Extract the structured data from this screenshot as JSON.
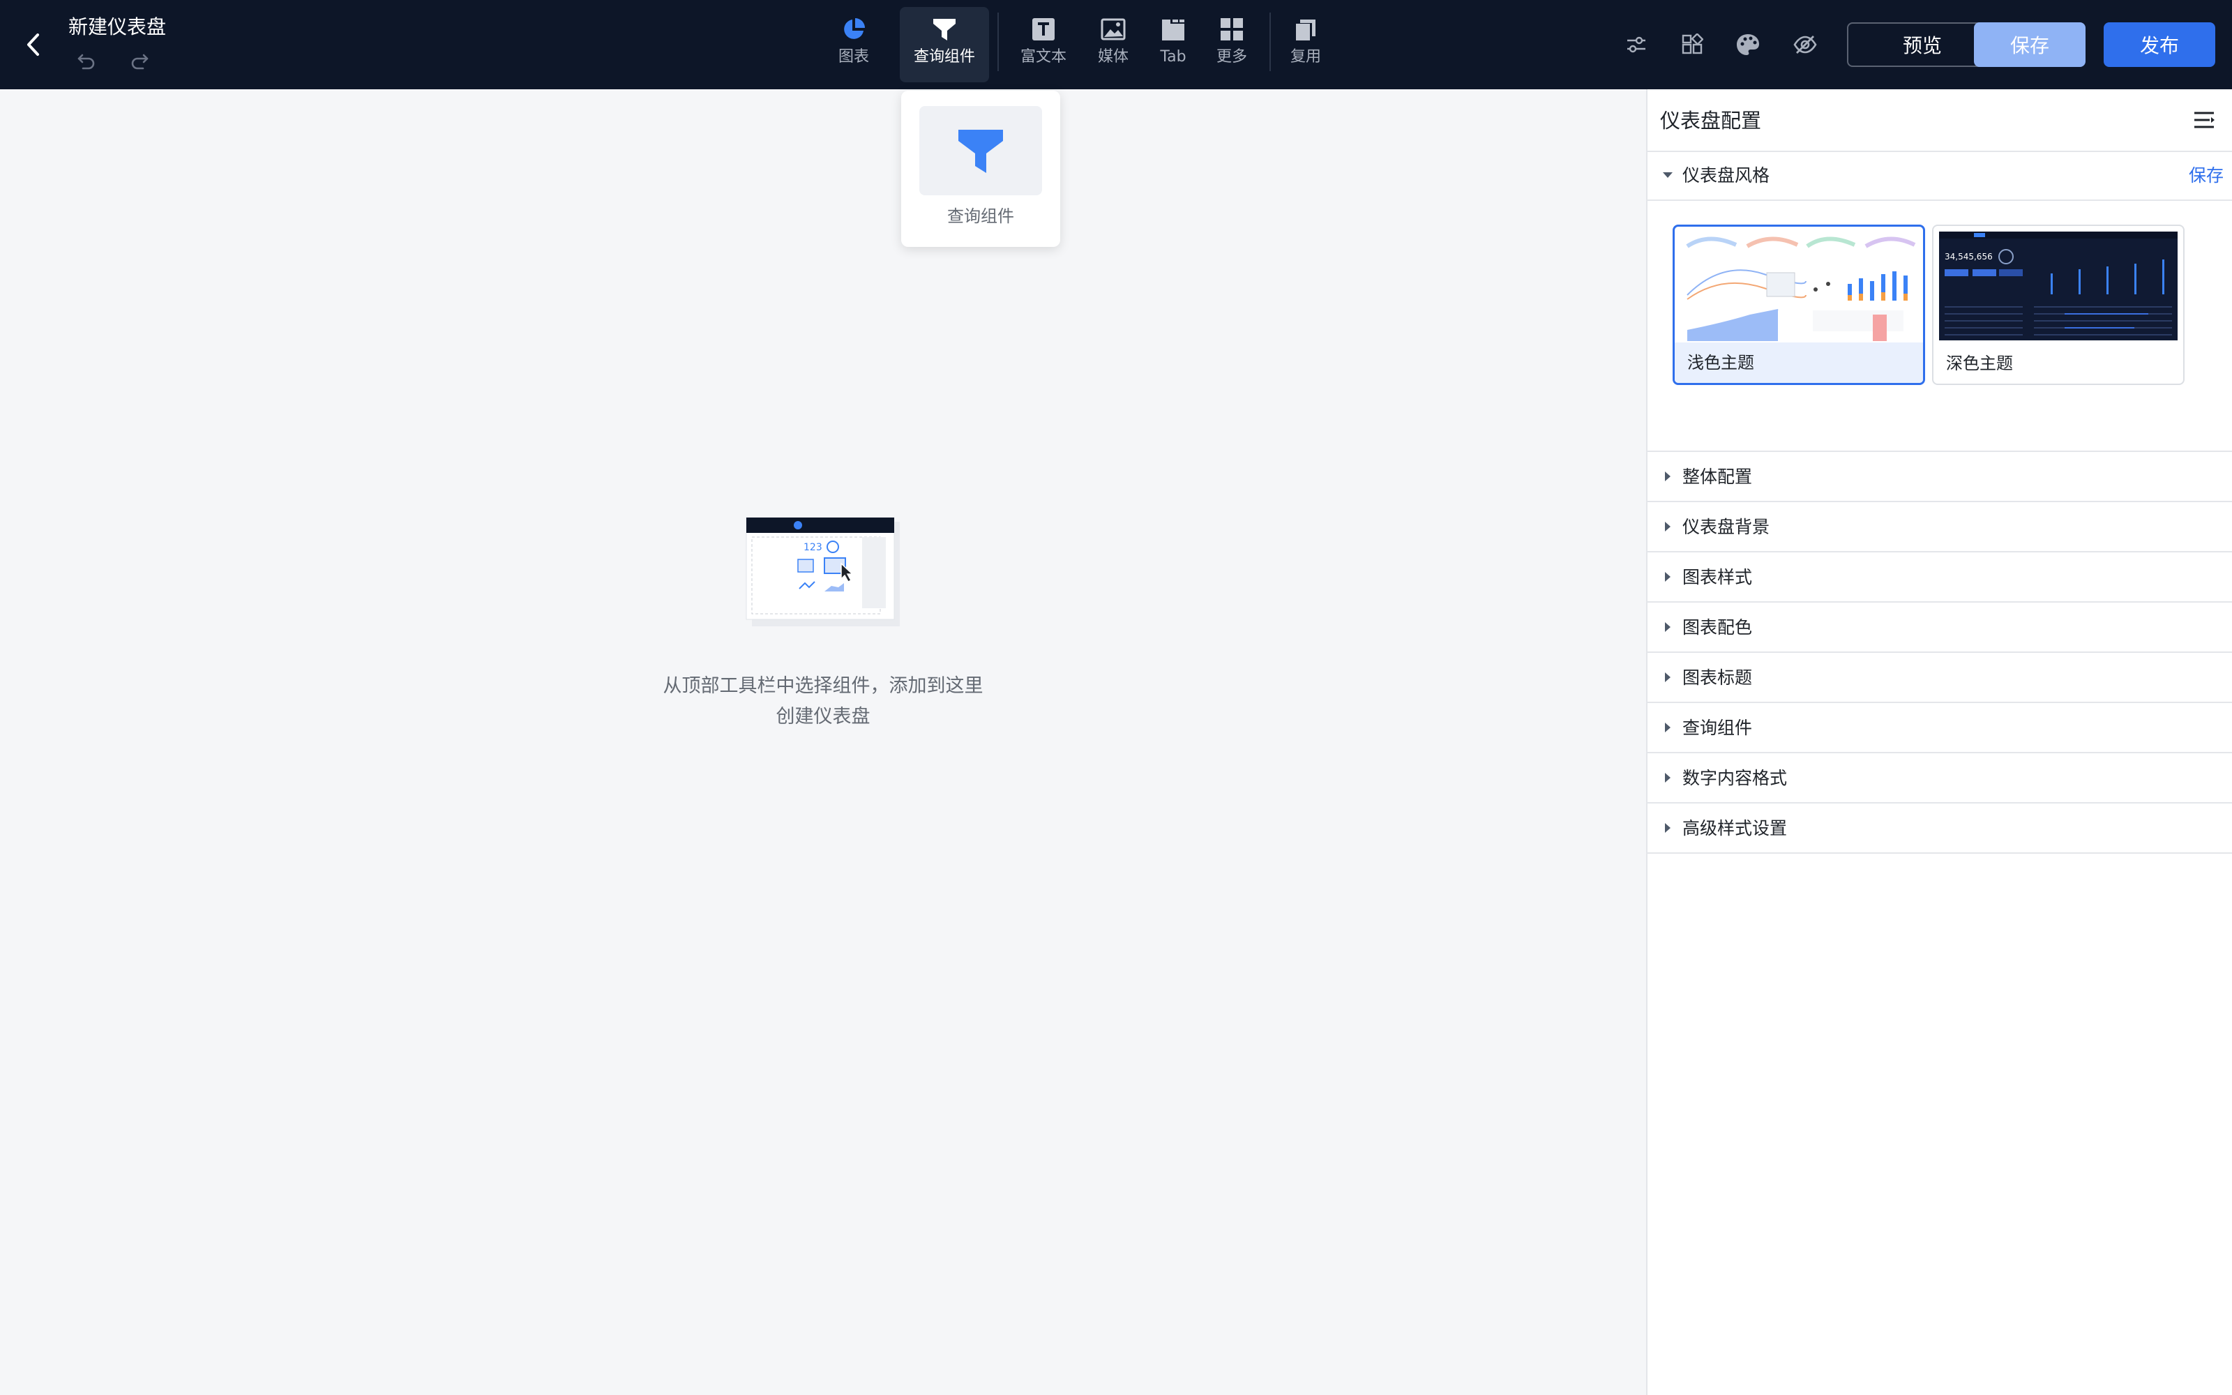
{
  "header": {
    "title": "新建仪表盘",
    "toolbar": [
      {
        "id": "chart",
        "label": "图表",
        "icon": "pie-chart-icon"
      },
      {
        "id": "query",
        "label": "查询组件",
        "icon": "filter-icon",
        "active": true
      },
      {
        "id": "richtext",
        "label": "富文本",
        "icon": "text-icon"
      },
      {
        "id": "media",
        "label": "媒体",
        "icon": "image-icon"
      },
      {
        "id": "tab",
        "label": "Tab",
        "icon": "tab-icon"
      },
      {
        "id": "more",
        "label": "更多",
        "icon": "grid-icon"
      },
      {
        "id": "reuse",
        "label": "复用",
        "icon": "copy-icon"
      }
    ],
    "buttons": {
      "preview": "预览",
      "save": "保存",
      "publish": "发布"
    }
  },
  "popover": {
    "item_label": "查询组件"
  },
  "canvas": {
    "empty_line1": "从顶部工具栏中选择组件，添加到这里",
    "empty_line2": "创建仪表盘"
  },
  "panel": {
    "title": "仪表盘配置",
    "style_section": {
      "title": "仪表盘风格",
      "save_label": "保存",
      "themes": [
        {
          "name": "浅色主题",
          "selected": true
        },
        {
          "name": "深色主题",
          "selected": false
        }
      ]
    },
    "sections": [
      "整体配置",
      "仪表盘背景",
      "图表样式",
      "图表配色",
      "图表标题",
      "查询组件",
      "数字内容格式",
      "高级样式设置"
    ]
  },
  "thumbs": {
    "dark_kpi": "34,545,656"
  },
  "colors": {
    "topbar": "#0d1628",
    "accent": "#2f6fec",
    "accent_light": "#8fb3f5"
  }
}
